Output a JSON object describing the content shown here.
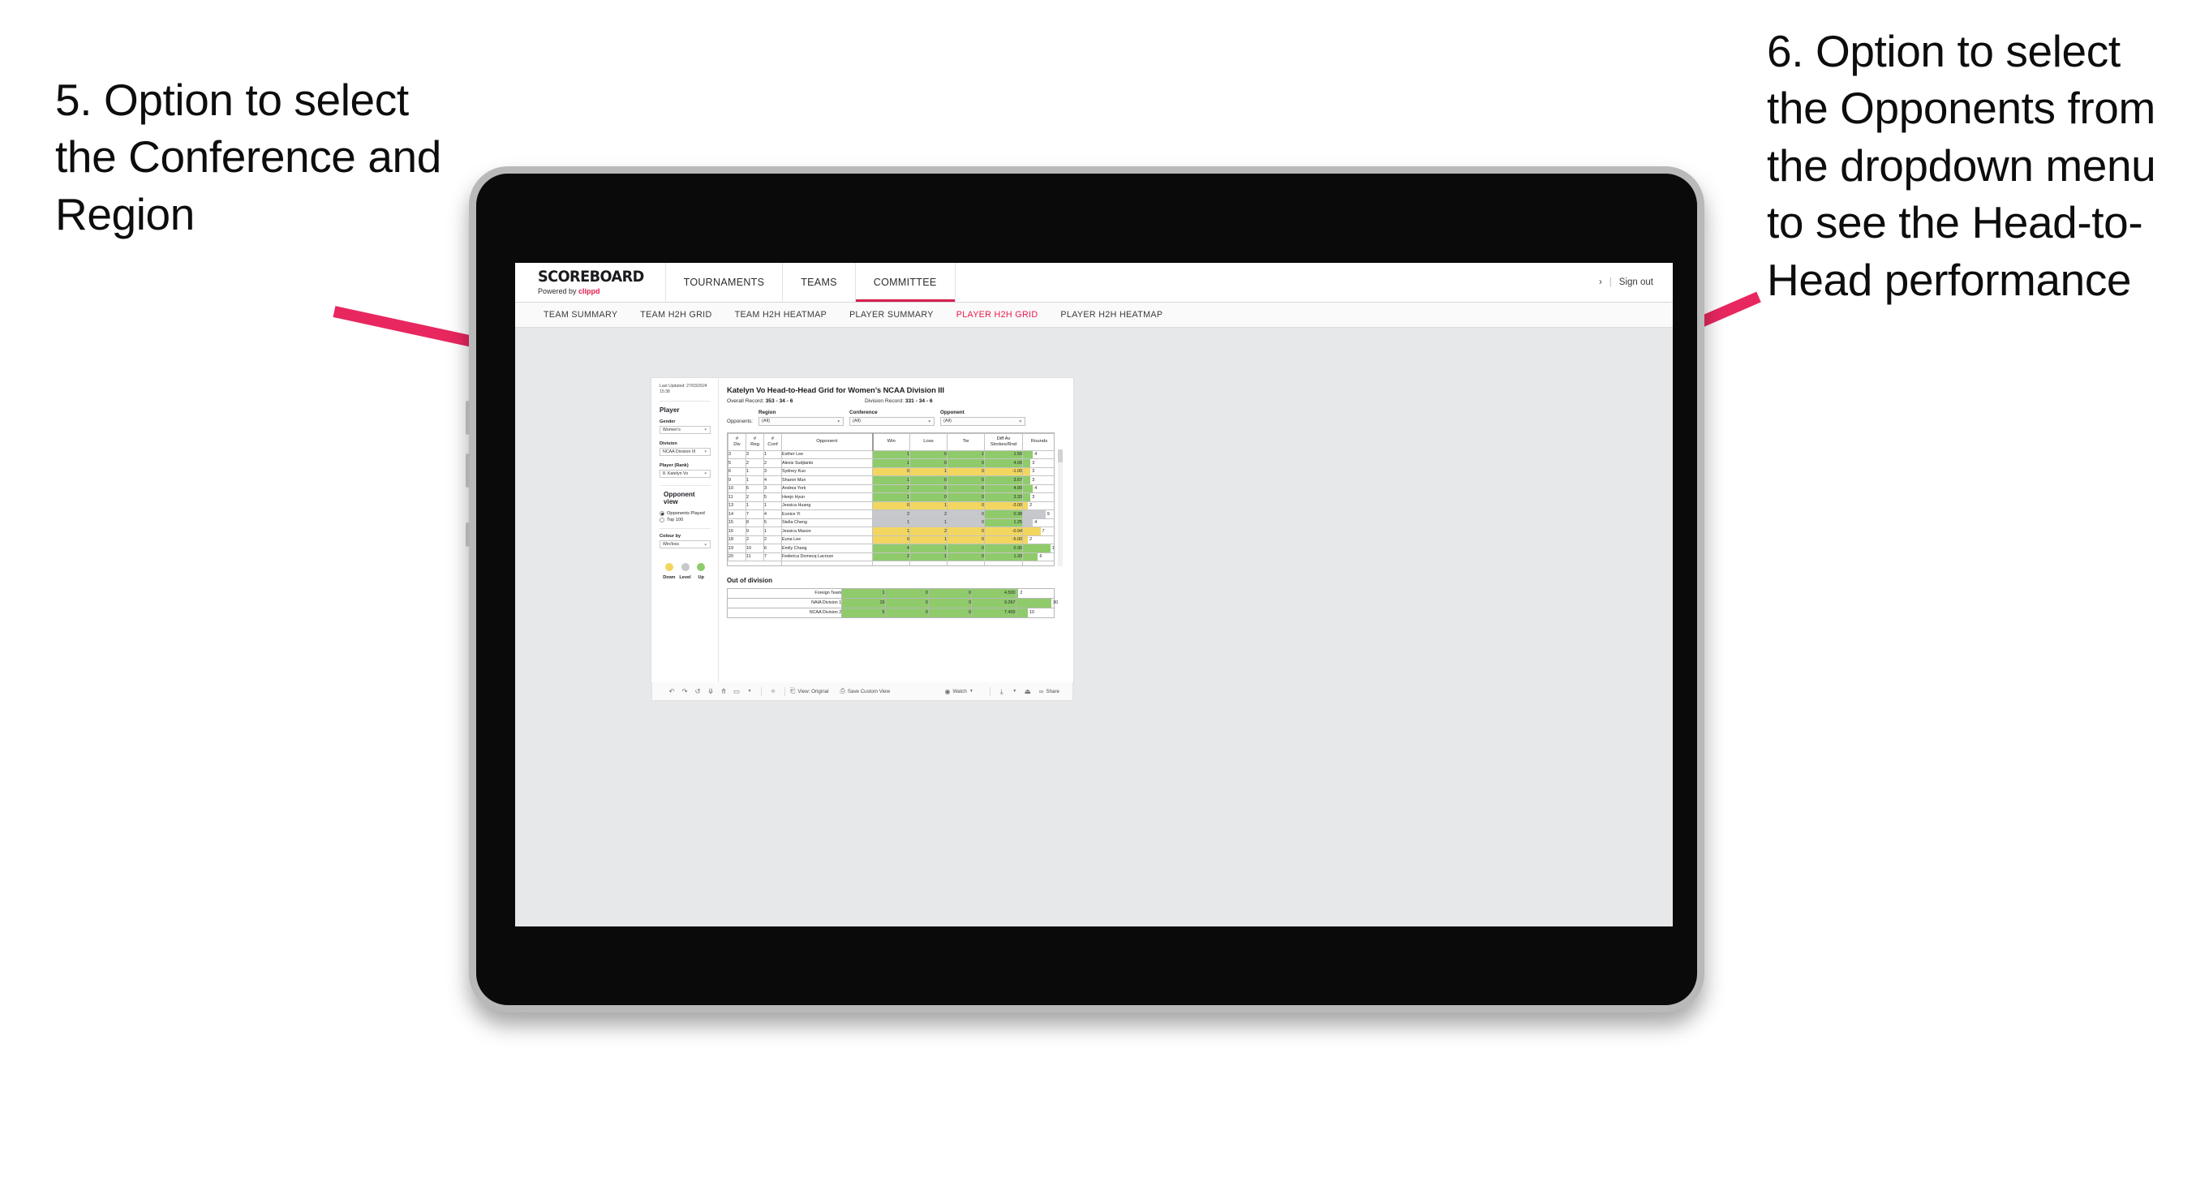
{
  "annotations": {
    "left": "5. Option to select the Conference and Region",
    "right": "6. Option to select the Opponents from the dropdown menu to see the Head-to-Head performance",
    "arrow_color": "#e8275f"
  },
  "app": {
    "brand": {
      "title": "SCOREBOARD",
      "powered_prefix": "Powered by ",
      "powered_brand": "clippd"
    },
    "topnav": [
      {
        "label": "TOURNAMENTS",
        "active": false
      },
      {
        "label": "TEAMS",
        "active": false
      },
      {
        "label": "COMMITTEE",
        "active": true
      }
    ],
    "account": {
      "chevron": "›",
      "divider": "|",
      "signout": "Sign out"
    },
    "subnav": [
      {
        "label": "TEAM SUMMARY",
        "active": false
      },
      {
        "label": "TEAM H2H GRID",
        "active": false
      },
      {
        "label": "TEAM H2H HEATMAP",
        "active": false
      },
      {
        "label": "PLAYER SUMMARY",
        "active": false
      },
      {
        "label": "PLAYER H2H GRID",
        "active": true
      },
      {
        "label": "PLAYER H2H HEATMAP",
        "active": false
      }
    ]
  },
  "sidebar": {
    "last_updated": "Last Updated: 27/03/2024 15:38",
    "player_heading": "Player",
    "gender": {
      "label": "Gender",
      "value": "Women’s"
    },
    "division": {
      "label": "Division",
      "value": "NCAA Division III"
    },
    "player_rank": {
      "label": "Player (Rank)",
      "value": "8. Katelyn Vo"
    },
    "opponent_view": {
      "heading": "Opponent view",
      "options": [
        {
          "label": "Opponents Played",
          "selected": true
        },
        {
          "label": "Top 100",
          "selected": false
        }
      ]
    },
    "colour_by": {
      "label": "Colour by",
      "value": "Win/loss"
    },
    "legend": [
      {
        "label": "Down",
        "color": "#f2d65f"
      },
      {
        "label": "Level",
        "color": "#c6c8cc"
      },
      {
        "label": "Up",
        "color": "#8fcb6b"
      }
    ]
  },
  "main": {
    "title": "Katelyn Vo Head-to-Head Grid for Women’s NCAA Division III",
    "overall_record_label": "Overall Record: ",
    "overall_record_value": "353 - 34 - 6",
    "division_record_label": "Division Record: ",
    "division_record_value": "331 - 34 - 6",
    "opponents_label": "Opponents:",
    "filters": [
      {
        "name": "Region",
        "value": "(All)"
      },
      {
        "name": "Conference",
        "value": "(All)"
      },
      {
        "name": "Opponent",
        "value": "(All)"
      }
    ]
  },
  "chart_data": {
    "type": "table",
    "title": "Katelyn Vo Head-to-Head Grid for Women’s NCAA Division III",
    "columns": [
      "# Div",
      "# Reg",
      "# Conf",
      "Opponent",
      "Win",
      "Loss",
      "Tie",
      "Diff Av Strokes/Rnd",
      "Rounds"
    ],
    "column_headers_two_line": [
      {
        "l1": "#",
        "l2": "Div"
      },
      {
        "l1": "#",
        "l2": "Reg"
      },
      {
        "l1": "#",
        "l2": "Conf"
      },
      {
        "l1": "Opponent",
        "l2": ""
      },
      {
        "l1": "Win",
        "l2": ""
      },
      {
        "l1": "Loss",
        "l2": ""
      },
      {
        "l1": "Tie",
        "l2": ""
      },
      {
        "l1": "Diff Av",
        "l2": "Strokes/Rnd"
      },
      {
        "l1": "Rounds",
        "l2": ""
      }
    ],
    "rounds_max": 13,
    "rows": [
      {
        "div": "3",
        "reg": "3",
        "conf": "1",
        "opponent": "Esther Lee",
        "win": "1",
        "loss": "0",
        "tie": "1",
        "diff": "1.50",
        "rounds": "4",
        "rounds_n": 4,
        "color": "#8fcb6b"
      },
      {
        "div": "5",
        "reg": "2",
        "conf": "2",
        "opponent": "Alexis Sudjianto",
        "win": "1",
        "loss": "0",
        "tie": "0",
        "diff": "4.00",
        "rounds": "3",
        "rounds_n": 3,
        "color": "#8fcb6b"
      },
      {
        "div": "6",
        "reg": "1",
        "conf": "3",
        "opponent": "Sydney Kuo",
        "win": "0",
        "loss": "1",
        "tie": "0",
        "diff": "-1.00",
        "rounds": "3",
        "rounds_n": 3,
        "color": "#f2d65f"
      },
      {
        "div": "9",
        "reg": "1",
        "conf": "4",
        "opponent": "Sharon Mun",
        "win": "1",
        "loss": "0",
        "tie": "0",
        "diff": "3.67",
        "rounds": "3",
        "rounds_n": 3,
        "color": "#8fcb6b"
      },
      {
        "div": "10",
        "reg": "6",
        "conf": "3",
        "opponent": "Andrea York",
        "win": "2",
        "loss": "0",
        "tie": "0",
        "diff": "4.00",
        "rounds": "4",
        "rounds_n": 4,
        "color": "#8fcb6b"
      },
      {
        "div": "11",
        "reg": "2",
        "conf": "5",
        "opponent": "Heejo Hyun",
        "win": "1",
        "loss": "0",
        "tie": "0",
        "diff": "3.33",
        "rounds": "3",
        "rounds_n": 3,
        "color": "#8fcb6b"
      },
      {
        "div": "13",
        "reg": "1",
        "conf": "1",
        "opponent": "Jessica Huang",
        "win": "0",
        "loss": "1",
        "tie": "0",
        "diff": "-3.00",
        "rounds": "2",
        "rounds_n": 2,
        "color": "#f2d65f"
      },
      {
        "div": "14",
        "reg": "7",
        "conf": "4",
        "opponent": "Eunice Yi",
        "win": "2",
        "loss": "2",
        "tie": "0",
        "diff": "0.38",
        "rounds": "9",
        "rounds_n": 9,
        "color": "#c6c8cc",
        "diff_color": "#8fcb6b"
      },
      {
        "div": "15",
        "reg": "8",
        "conf": "5",
        "opponent": "Stella Cheng",
        "win": "1",
        "loss": "1",
        "tie": "0",
        "diff": "1.25",
        "rounds": "4",
        "rounds_n": 4,
        "color": "#c6c8cc",
        "diff_color": "#8fcb6b"
      },
      {
        "div": "16",
        "reg": "9",
        "conf": "1",
        "opponent": "Jessica Mason",
        "win": "1",
        "loss": "2",
        "tie": "0",
        "diff": "-0.94",
        "rounds": "7",
        "rounds_n": 7,
        "color": "#f2d65f"
      },
      {
        "div": "18",
        "reg": "2",
        "conf": "2",
        "opponent": "Euna Lee",
        "win": "0",
        "loss": "1",
        "tie": "0",
        "diff": "-5.00",
        "rounds": "2",
        "rounds_n": 2,
        "color": "#f2d65f"
      },
      {
        "div": "19",
        "reg": "10",
        "conf": "6",
        "opponent": "Emily Chang",
        "win": "4",
        "loss": "1",
        "tie": "0",
        "diff": "0.30",
        "rounds": "11",
        "rounds_n": 11,
        "color": "#8fcb6b"
      },
      {
        "div": "20",
        "reg": "11",
        "conf": "7",
        "opponent": "Federica Domecq Lacroze",
        "win": "2",
        "loss": "1",
        "tie": "0",
        "diff": "1.33",
        "rounds": "6",
        "rounds_n": 6,
        "color": "#8fcb6b"
      }
    ],
    "out_of_division": {
      "title": "Out of division",
      "rounds_max": 32,
      "rows": [
        {
          "name": "Foreign Team",
          "win": "1",
          "loss": "0",
          "tie": "0",
          "diff": "4.500",
          "rounds": "2",
          "rounds_n": 2,
          "color": "#8fcb6b"
        },
        {
          "name": "NAIA Division 1",
          "win": "15",
          "loss": "0",
          "tie": "0",
          "diff": "9.267",
          "rounds": "30",
          "rounds_n": 30,
          "color": "#8fcb6b"
        },
        {
          "name": "NCAA Division 2",
          "win": "5",
          "loss": "0",
          "tie": "0",
          "diff": "7.400",
          "rounds": "10",
          "rounds_n": 10,
          "color": "#8fcb6b"
        }
      ]
    }
  },
  "toolbar": {
    "icons": [
      "↶",
      "↷",
      "↺",
      "⇩",
      "⇧",
      "▭"
    ],
    "view_label": "View: Original",
    "save_label": "Save Custom View",
    "watch_label": "Watch",
    "share_label": "Share"
  }
}
